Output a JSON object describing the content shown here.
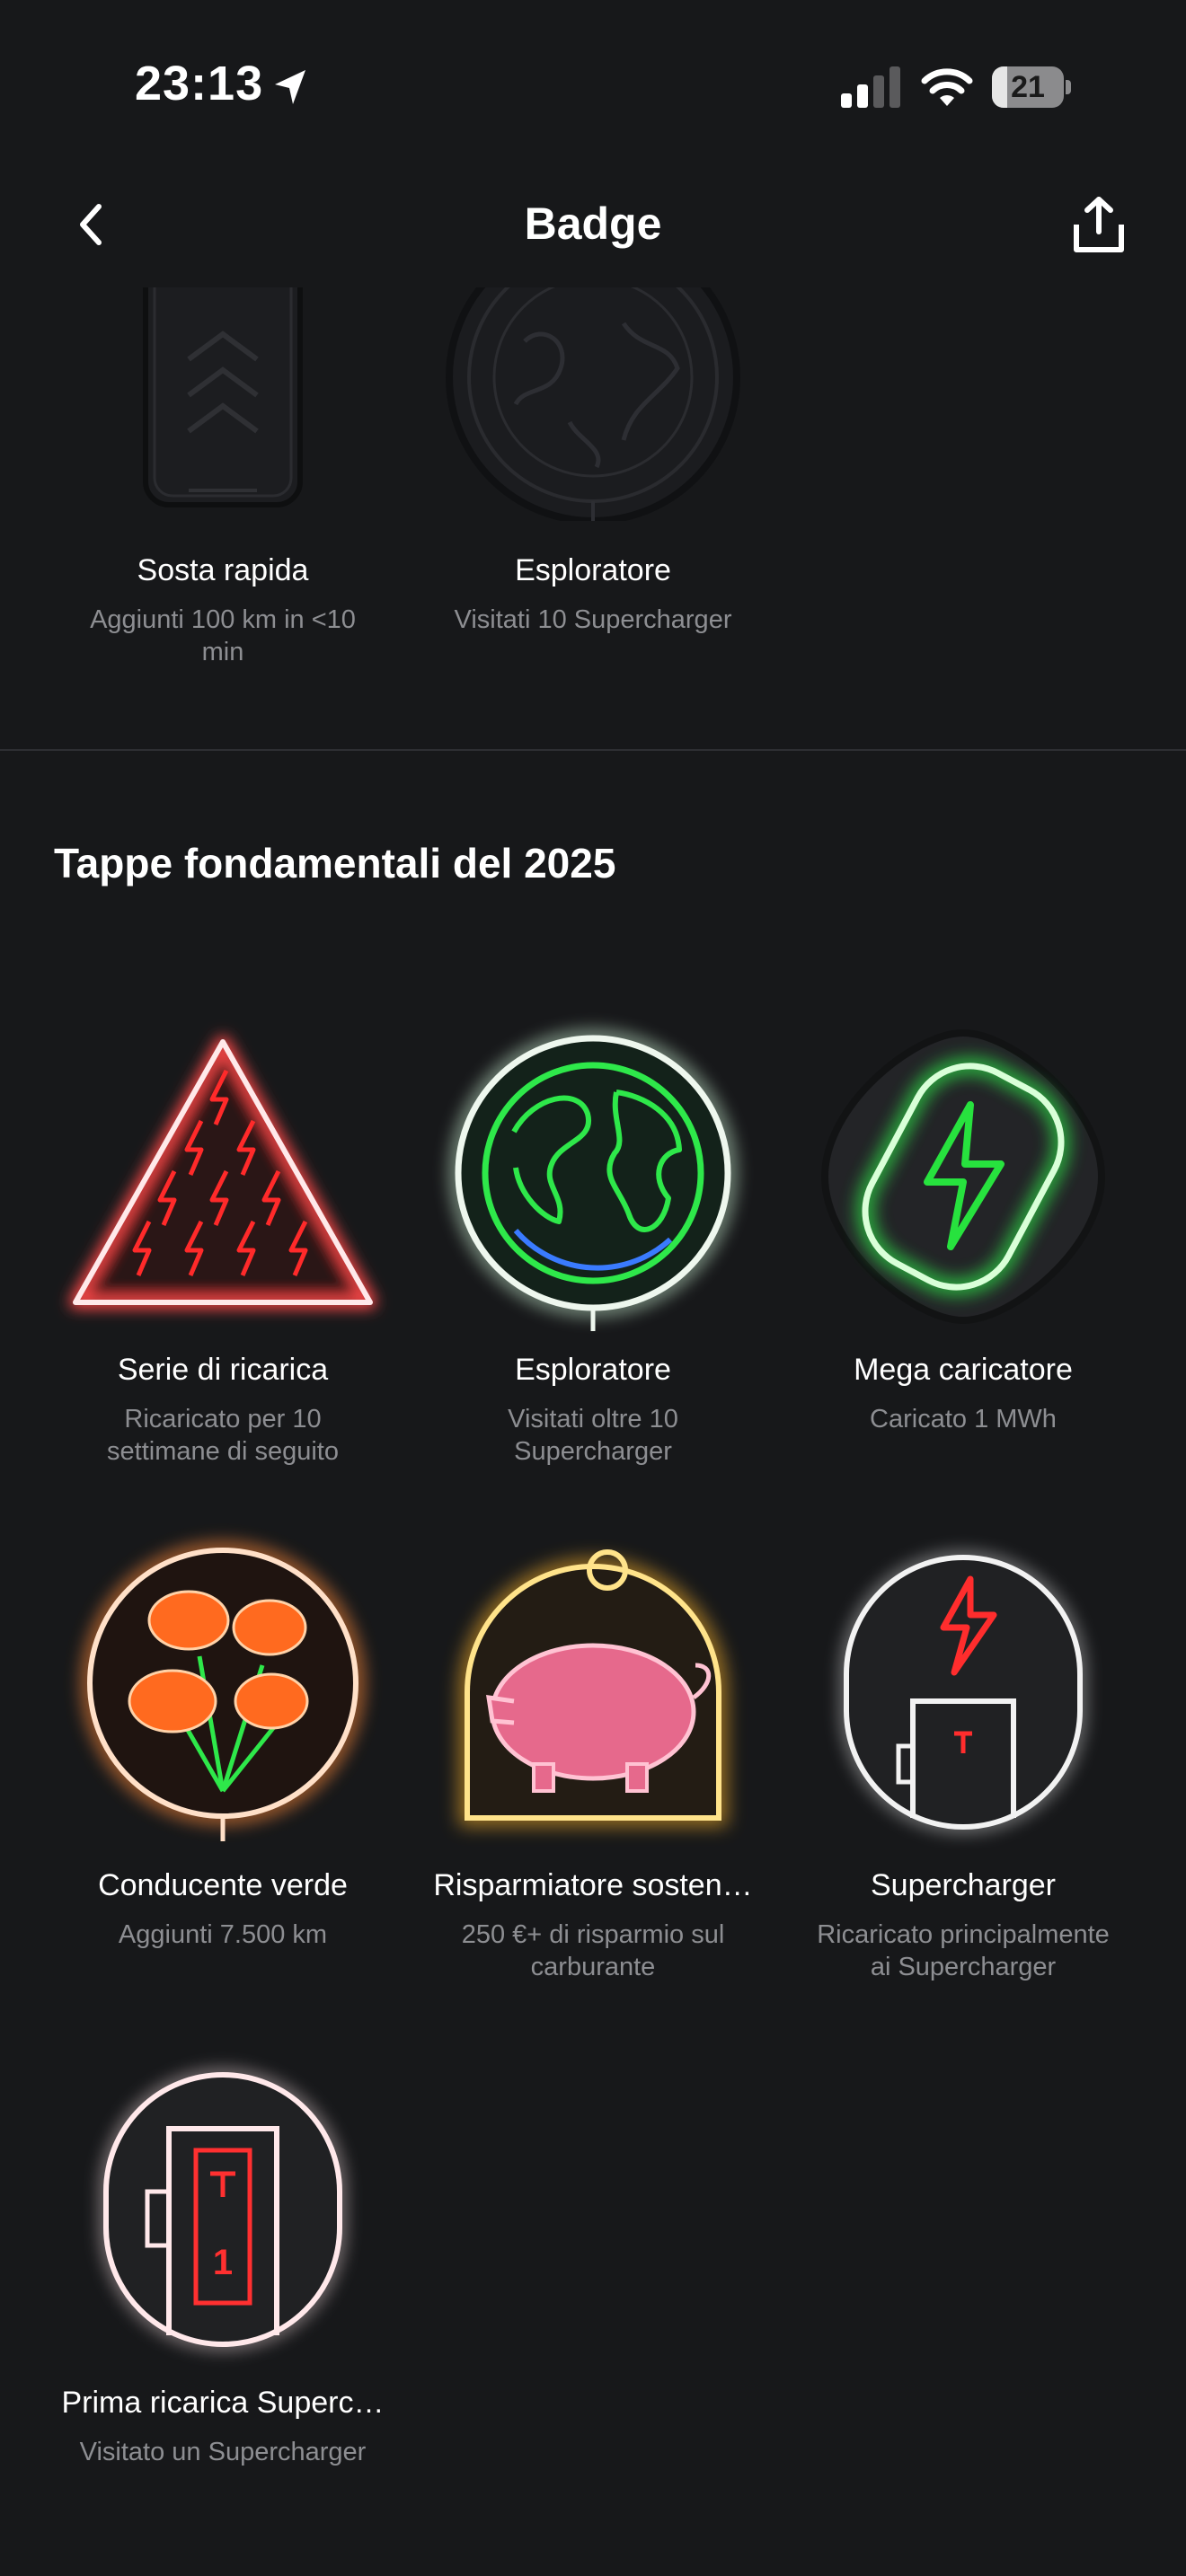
{
  "status_bar": {
    "time": "23:13",
    "battery_level": "21",
    "icons": [
      "location-arrow-icon",
      "cellular-signal-icon",
      "wifi-icon",
      "battery-icon"
    ]
  },
  "nav": {
    "title": "Badge",
    "back_icon": "chevron-left-icon",
    "share_icon": "share-upload-icon"
  },
  "earned_badges": [
    {
      "name": "Sosta rapida",
      "description": "Aggiunti 100 km in <10 min",
      "icon": "triple-chevron-up-icon"
    },
    {
      "name": "Esploratore",
      "description": "Visitati 10 Supercharger",
      "icon": "globe-icon"
    }
  ],
  "milestones": {
    "title": "Tappe fondamentali del 2025",
    "badges": [
      {
        "name": "Serie di ricarica",
        "description": "Ricaricato per 10 settimane di seguito",
        "icon": "lightning-triangle-icon",
        "color": "#ff2a2a"
      },
      {
        "name": "Esploratore",
        "description": "Visitati oltre 10 Supercharger",
        "icon": "neon-globe-icon",
        "color": "#2ee84a"
      },
      {
        "name": "Mega caricatore",
        "description": "Caricato 1 MWh",
        "icon": "neon-bolt-icon",
        "color": "#27e23e"
      },
      {
        "name": "Conducente verde",
        "description": "Aggiunti 7.500 km",
        "icon": "poppy-flowers-icon",
        "color": "#ff6a1f"
      },
      {
        "name": "Risparmiatore sosten…",
        "description": "250 €+ di risparmio sul carburante",
        "icon": "piggy-bank-icon",
        "color": "#ff8fb0"
      },
      {
        "name": "Supercharger",
        "description": "Ricaricato principalmente ai Supercharger",
        "icon": "supercharger-stall-icon",
        "color": "#ff2d2d"
      },
      {
        "name": "Prima ricarica Superc…",
        "description": "Visitato un Supercharger",
        "icon": "supercharger-first-icon",
        "color": "#ff3030",
        "stall_number": "1"
      }
    ]
  }
}
